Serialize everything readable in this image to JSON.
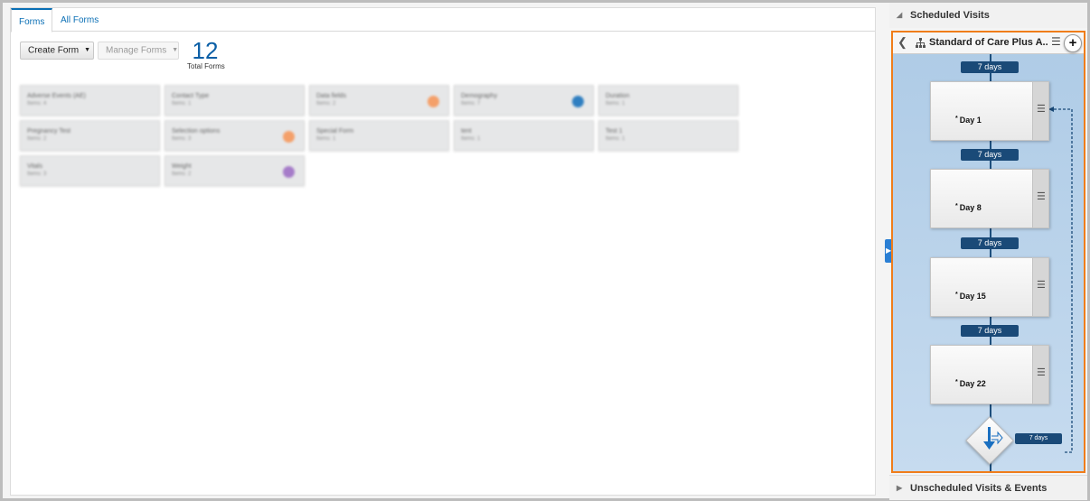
{
  "tabs": [
    {
      "label": "Forms",
      "active": true
    },
    {
      "label": "All Forms",
      "active": false
    }
  ],
  "toolbar": {
    "create_label": "Create Form",
    "manage_label": "Manage Forms"
  },
  "summary": {
    "total_count": "12",
    "total_label": "Total Forms"
  },
  "forms": [
    {
      "name": "Adverse Events (AE)",
      "meta": "Items: 4",
      "dot": ""
    },
    {
      "name": "Contact Type",
      "meta": "Items: 1",
      "dot": ""
    },
    {
      "name": "Data fields",
      "meta": "Items: 2",
      "dot": "#f4a06a"
    },
    {
      "name": "Demography",
      "meta": "Items: 7",
      "dot": "#2f7fc1"
    },
    {
      "name": "Duration",
      "meta": "Items: 1",
      "dot": ""
    },
    {
      "name": "Pregnancy Test",
      "meta": "Items: 2",
      "dot": ""
    },
    {
      "name": "Selection options",
      "meta": "Items: 3",
      "dot": "#f4a06a"
    },
    {
      "name": "Special Form",
      "meta": "Items: 1",
      "dot": ""
    },
    {
      "name": "tent",
      "meta": "Items: 1",
      "dot": ""
    },
    {
      "name": "Test 1",
      "meta": "Items: 1",
      "dot": ""
    },
    {
      "name": "Vitals",
      "meta": "Items: 3",
      "dot": ""
    },
    {
      "name": "Weight",
      "meta": "Items: 2",
      "dot": "#a67cc9"
    }
  ],
  "schedule": {
    "section_title": "Scheduled Visits",
    "title": "Standard of Care Plus A...",
    "intervals": [
      "7 days",
      "7 days",
      "7 days",
      "7 days"
    ],
    "visits": [
      {
        "label": "Day 1",
        "required_mark": "*"
      },
      {
        "label": "Day 8",
        "required_mark": "*"
      },
      {
        "label": "Day 15",
        "required_mark": "*"
      },
      {
        "label": "Day 22",
        "required_mark": "*"
      }
    ],
    "loop_interval": "7 days"
  },
  "unscheduled": {
    "section_title": "Unscheduled Visits & Events"
  },
  "colors": {
    "accent": "#0a6fb5",
    "highlight_border": "#f07d1a",
    "interval_badge": "#1a4a78"
  },
  "icons": {
    "back": "chevron-left-icon",
    "tree": "hierarchy-icon",
    "menu": "hamburger-menu-icon",
    "add": "plus-icon",
    "branch": "branch-arrow-icon"
  }
}
